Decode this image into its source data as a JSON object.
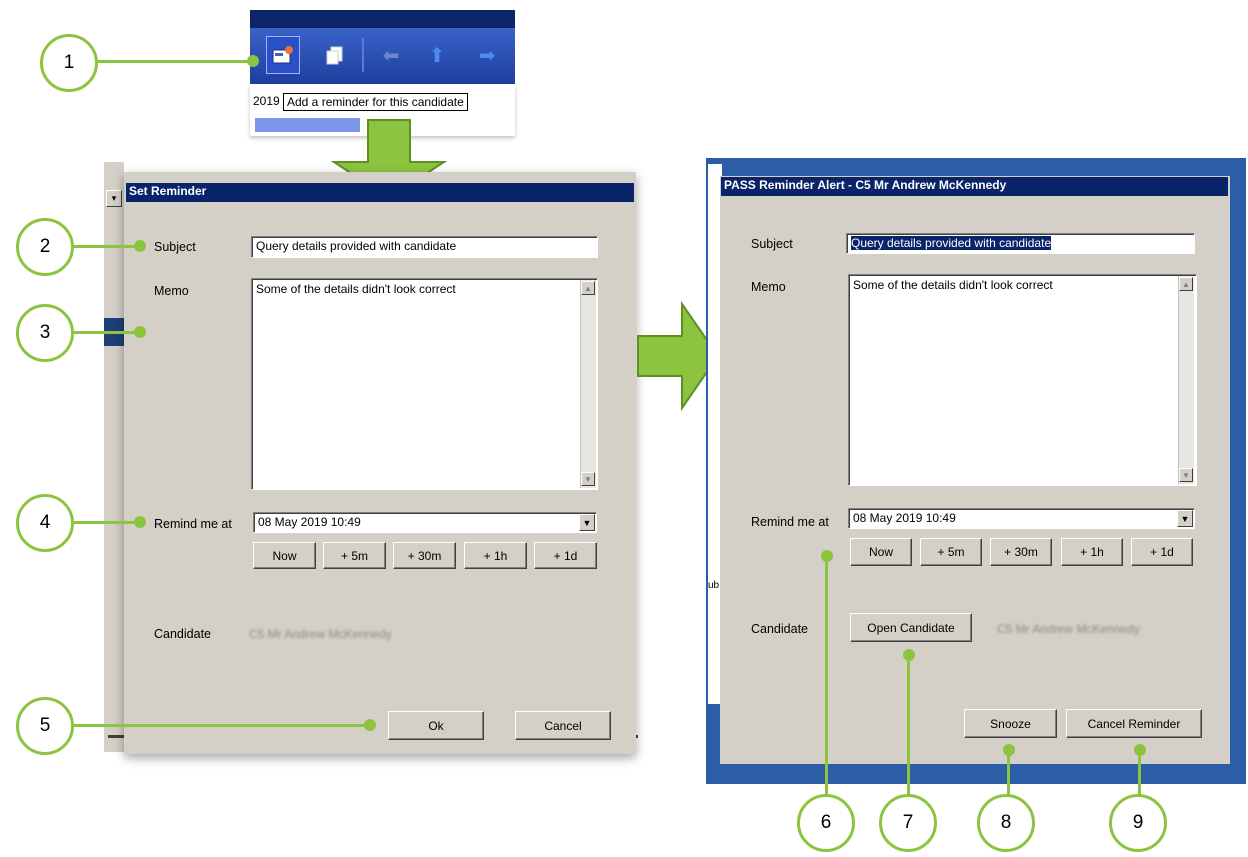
{
  "toolbar": {
    "year_fragment": "2019",
    "tooltip": "Add a reminder for this candidate",
    "icons": [
      "add-reminder-icon",
      "copy-icon",
      "back-arrow-icon",
      "up-arrow-icon",
      "forward-arrow-icon"
    ]
  },
  "set_reminder": {
    "title": "Set Reminder",
    "subject_label": "Subject",
    "subject_value": "Query details provided with candidate",
    "memo_label": "Memo",
    "memo_value": "Some of the details didn't look correct",
    "remind_label": "Remind me at",
    "remind_value": "08 May 2019 10:49",
    "quick_buttons": [
      "Now",
      "+ 5m",
      "+ 30m",
      "+ 1h",
      "+ 1d"
    ],
    "candidate_label": "Candidate",
    "candidate_value": "C5 Mr Andrew McKennedy",
    "ok_label": "Ok",
    "cancel_label": "Cancel"
  },
  "alert": {
    "title": "PASS Reminder Alert - C5 Mr Andrew McKennedy",
    "subject_label": "Subject",
    "subject_value": "Query details provided with candidate",
    "memo_label": "Memo",
    "memo_value": "Some of the details didn't look correct",
    "remind_label": "Remind me at",
    "remind_value": "08 May 2019 10:49",
    "quick_buttons": [
      "Now",
      "+ 5m",
      "+ 30m",
      "+ 1h",
      "+ 1d"
    ],
    "candidate_label": "Candidate",
    "open_candidate_label": "Open Candidate",
    "candidate_value": "C5 Mr Andrew McKennedy",
    "snooze_label": "Snooze",
    "cancel_reminder_label": "Cancel Reminder"
  },
  "callouts": [
    "1",
    "2",
    "3",
    "4",
    "5",
    "6",
    "7",
    "8",
    "9"
  ],
  "colors": {
    "accent_green": "#8cc43f",
    "title_bar": "#0a246a",
    "dialog_bg": "#d4d0c8"
  }
}
